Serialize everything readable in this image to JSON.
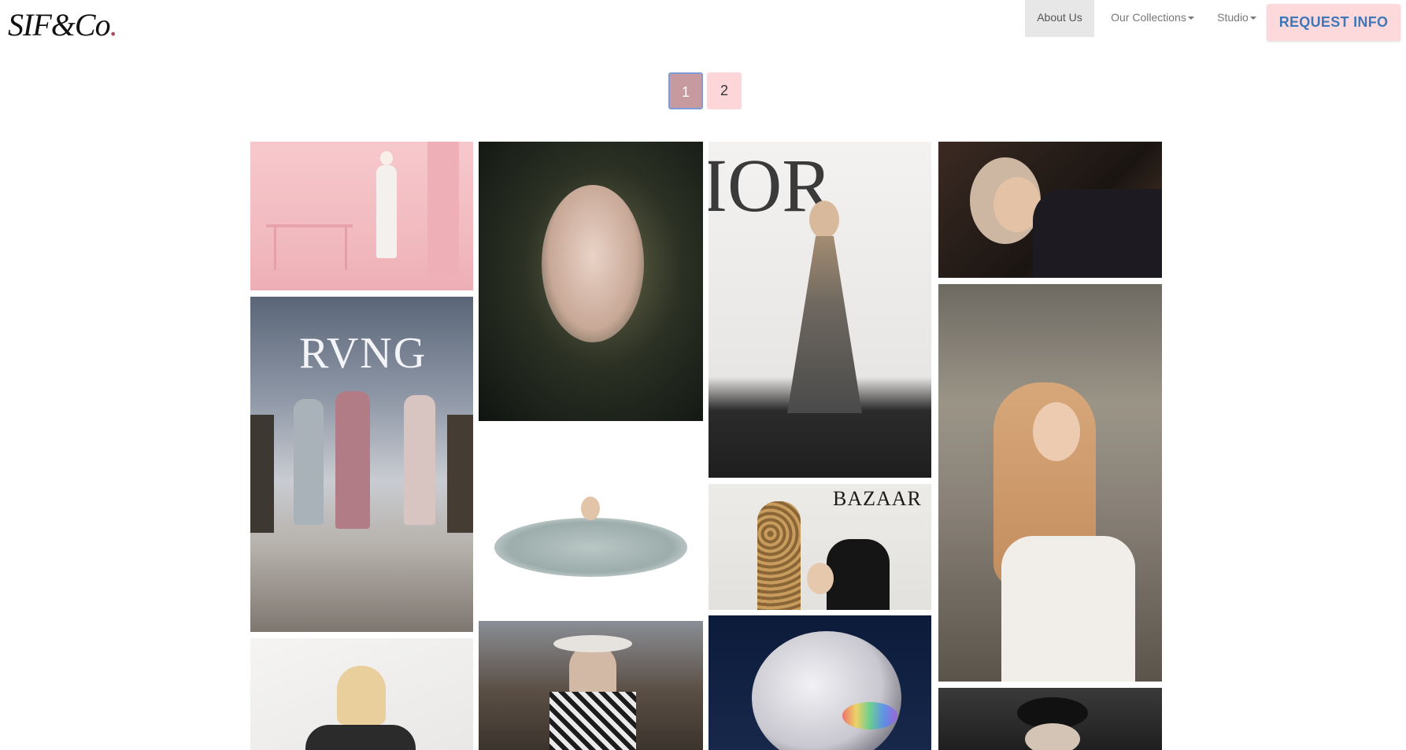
{
  "brand": {
    "logo_text": "SIF",
    "logo_amp": "&",
    "logo_suffix": "Co",
    "logo_dot": "."
  },
  "nav": {
    "items": [
      {
        "label": "About Us",
        "active": true,
        "dropdown": false
      },
      {
        "label": "Our Collections",
        "active": false,
        "dropdown": true
      },
      {
        "label": "Studio",
        "active": false,
        "dropdown": true
      }
    ],
    "cta_label": "REQUEST INFO"
  },
  "pagination": {
    "pages": [
      "1",
      "2"
    ],
    "current": "1"
  },
  "gallery": {
    "captions": {
      "runway": "RVNG",
      "dior": "IOR",
      "bazaar": "BAZAAR"
    }
  },
  "colors": {
    "cta_bg": "#fdd9dc",
    "cta_text": "#3f78b8",
    "page_active_bg": "#c79a9f",
    "page_inactive_bg": "#fdd6d9",
    "nav_active_bg": "#e7e7e7"
  }
}
